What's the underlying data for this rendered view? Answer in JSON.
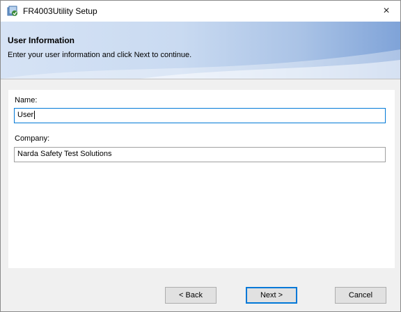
{
  "window": {
    "title": "FR4003Utility Setup",
    "close_glyph": "×",
    "app_icon": "installer-icon"
  },
  "banner": {
    "title": "User Information",
    "subtitle": "Enter your user information and click Next to continue."
  },
  "form": {
    "name_label": "Name:",
    "name_value": "User",
    "company_label": "Company:",
    "company_value": "Narda Safety Test Solutions"
  },
  "buttons": {
    "back": "< Back",
    "next": "Next >",
    "cancel": "Cancel"
  },
  "colors": {
    "accent": "#0078d7",
    "banner_light": "#d6e3f5",
    "banner_dark": "#7fa3d8"
  }
}
